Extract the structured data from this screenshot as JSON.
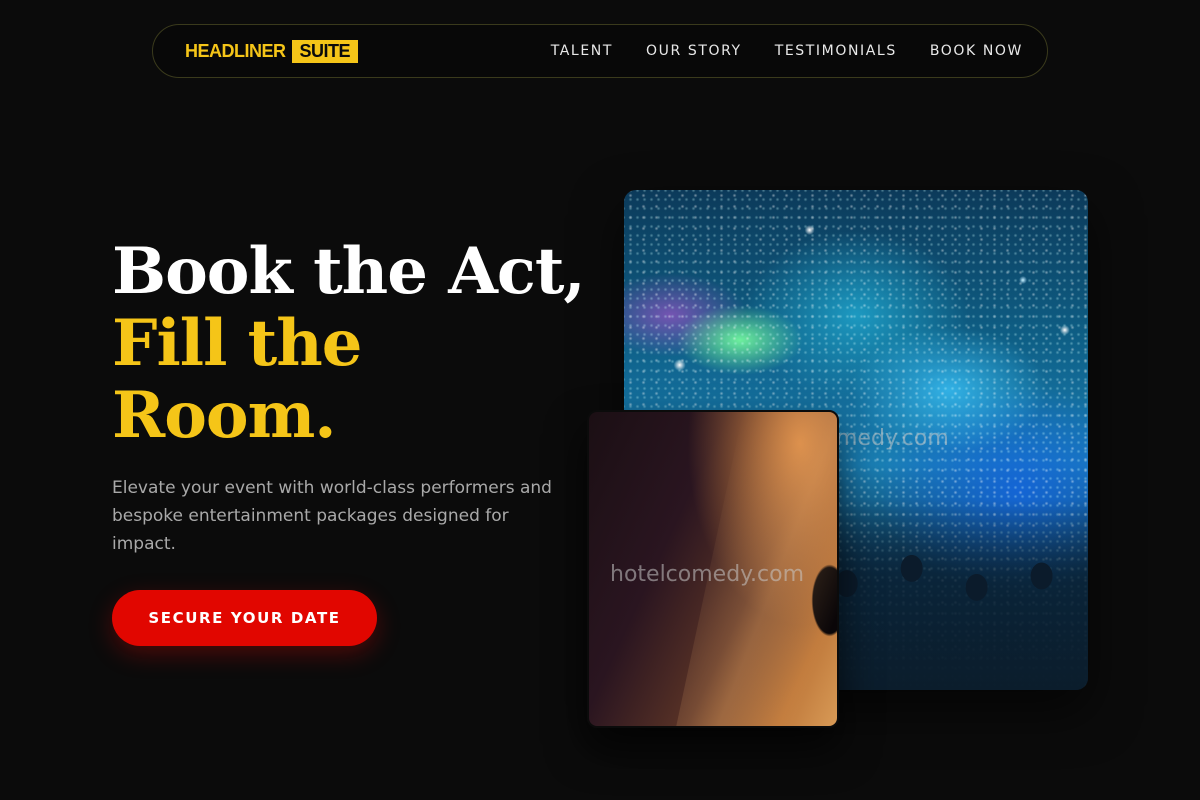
{
  "nav": {
    "logo_main": "HEADLINER",
    "logo_badge": "SUITE",
    "links": [
      "TALENT",
      "OUR STORY",
      "TESTIMONIALS",
      "BOOK NOW"
    ]
  },
  "hero": {
    "title_line1": "Book the Act,",
    "title_line2": "Fill the",
    "title_line3": "Room.",
    "description": "Elevate your event with world-class performers and bespoke entertainment packages designed for impact.",
    "cta_label": "SECURE YOUR DATE"
  },
  "images": {
    "concert_watermark": "medy.com",
    "comedy_watermark": "hotelcomedy.com"
  },
  "colors": {
    "accent_yellow": "#f5c518",
    "cta_red": "#e10600",
    "background": "#0b0b0b"
  }
}
